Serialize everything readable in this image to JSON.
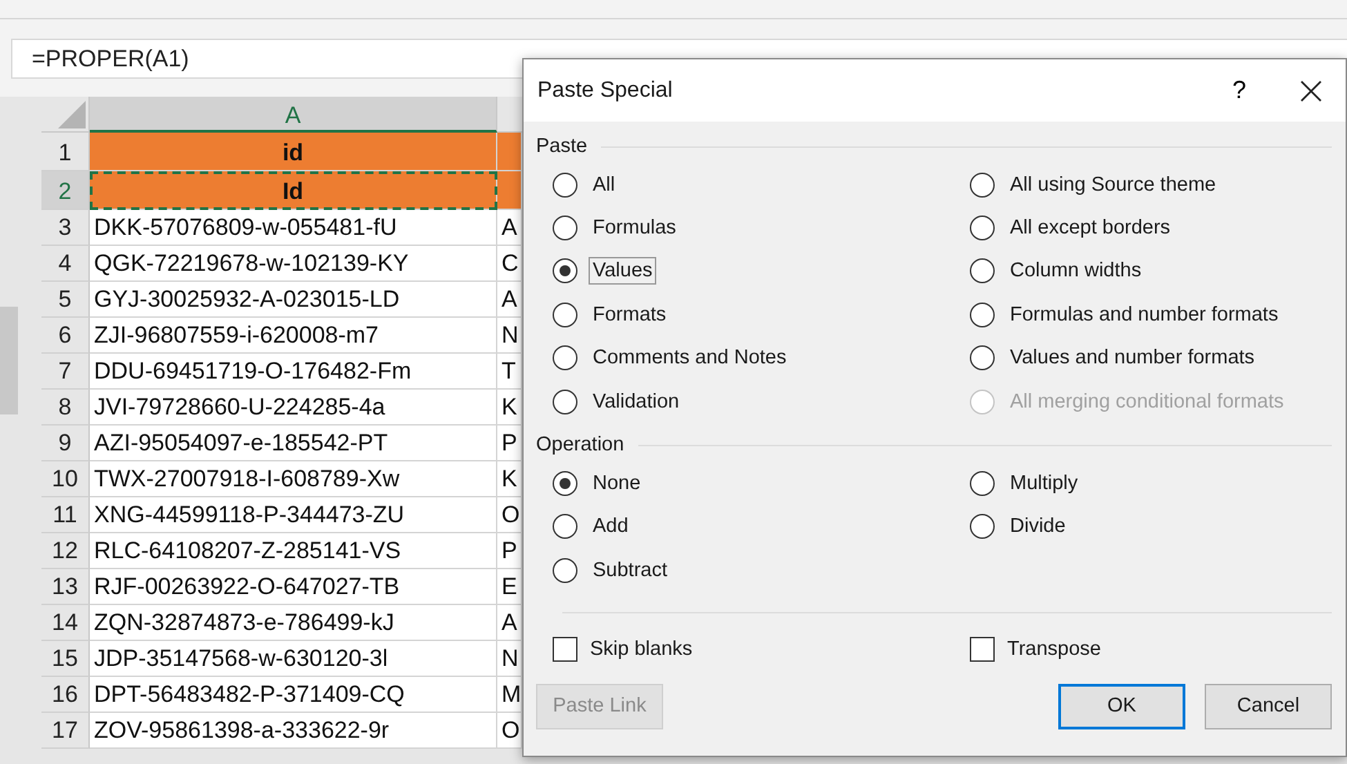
{
  "formula_bar": {
    "value": "=PROPER(A1)"
  },
  "sheet": {
    "columns": [
      {
        "label": "A",
        "selected": true
      }
    ],
    "rows": [
      {
        "number": "1",
        "kind": "header",
        "selected": false,
        "cells": [
          "id"
        ]
      },
      {
        "number": "2",
        "kind": "header",
        "selected": true,
        "cells": [
          "Id"
        ]
      },
      {
        "number": "3",
        "kind": "data",
        "selected": false,
        "cells": [
          "DKK-57076809-w-055481-fU",
          "A"
        ]
      },
      {
        "number": "4",
        "kind": "data",
        "selected": false,
        "cells": [
          "QGK-72219678-w-102139-KY",
          "C"
        ]
      },
      {
        "number": "5",
        "kind": "data",
        "selected": false,
        "cells": [
          "GYJ-30025932-A-023015-LD",
          "A"
        ]
      },
      {
        "number": "6",
        "kind": "data",
        "selected": false,
        "cells": [
          "ZJI-96807559-i-620008-m7",
          "N"
        ]
      },
      {
        "number": "7",
        "kind": "data",
        "selected": false,
        "cells": [
          "DDU-69451719-O-176482-Fm",
          "T"
        ]
      },
      {
        "number": "8",
        "kind": "data",
        "selected": false,
        "cells": [
          "JVI-79728660-U-224285-4a",
          "K"
        ]
      },
      {
        "number": "9",
        "kind": "data",
        "selected": false,
        "cells": [
          "AZI-95054097-e-185542-PT",
          "P"
        ]
      },
      {
        "number": "10",
        "kind": "data",
        "selected": false,
        "cells": [
          "TWX-27007918-I-608789-Xw",
          "K"
        ]
      },
      {
        "number": "11",
        "kind": "data",
        "selected": false,
        "cells": [
          "XNG-44599118-P-344473-ZU",
          "O"
        ]
      },
      {
        "number": "12",
        "kind": "data",
        "selected": false,
        "cells": [
          "RLC-64108207-Z-285141-VS",
          "P"
        ]
      },
      {
        "number": "13",
        "kind": "data",
        "selected": false,
        "cells": [
          "RJF-00263922-O-647027-TB",
          "E"
        ]
      },
      {
        "number": "14",
        "kind": "data",
        "selected": false,
        "cells": [
          "ZQN-32874873-e-786499-kJ",
          "A"
        ]
      },
      {
        "number": "15",
        "kind": "data",
        "selected": false,
        "cells": [
          "JDP-35147568-w-630120-3l",
          "N"
        ]
      },
      {
        "number": "16",
        "kind": "data",
        "selected": false,
        "cells": [
          "DPT-56483482-P-371409-CQ",
          "M"
        ]
      },
      {
        "number": "17",
        "kind": "data",
        "selected": false,
        "cells": [
          "ZOV-95861398-a-333622-9r",
          "O"
        ]
      }
    ]
  },
  "dialog": {
    "title": "Paste Special",
    "help": "?",
    "paste": {
      "label": "Paste",
      "options": [
        {
          "label": "All",
          "selected": false,
          "focused": false,
          "disabled": false
        },
        {
          "label": "Formulas",
          "selected": false,
          "focused": false,
          "disabled": false
        },
        {
          "label": "Values",
          "selected": true,
          "focused": true,
          "disabled": false
        },
        {
          "label": "Formats",
          "selected": false,
          "focused": false,
          "disabled": false
        },
        {
          "label": "Comments and Notes",
          "selected": false,
          "focused": false,
          "disabled": false
        },
        {
          "label": "Validation",
          "selected": false,
          "focused": false,
          "disabled": false
        },
        {
          "label": "All using Source theme",
          "selected": false,
          "focused": false,
          "disabled": false
        },
        {
          "label": "All except borders",
          "selected": false,
          "focused": false,
          "disabled": false
        },
        {
          "label": "Column widths",
          "selected": false,
          "focused": false,
          "disabled": false
        },
        {
          "label": "Formulas and number formats",
          "selected": false,
          "focused": false,
          "disabled": false
        },
        {
          "label": "Values and number formats",
          "selected": false,
          "focused": false,
          "disabled": false
        },
        {
          "label": "All merging conditional formats",
          "selected": false,
          "focused": false,
          "disabled": true
        }
      ]
    },
    "operation": {
      "label": "Operation",
      "options": [
        {
          "label": "None",
          "selected": true,
          "focused": false,
          "disabled": false
        },
        {
          "label": "Add",
          "selected": false,
          "focused": false,
          "disabled": false
        },
        {
          "label": "Subtract",
          "selected": false,
          "focused": false,
          "disabled": false
        },
        {
          "label": "Multiply",
          "selected": false,
          "focused": false,
          "disabled": false
        },
        {
          "label": "Divide",
          "selected": false,
          "focused": false,
          "disabled": false
        }
      ]
    },
    "checkboxes": [
      {
        "label": "Skip blanks",
        "checked": false
      },
      {
        "label": "Transpose",
        "checked": false
      }
    ],
    "buttons": [
      {
        "label": "Paste Link",
        "disabled": true,
        "default": false
      },
      {
        "label": "OK",
        "disabled": false,
        "default": true
      },
      {
        "label": "Cancel",
        "disabled": false,
        "default": false
      }
    ]
  }
}
